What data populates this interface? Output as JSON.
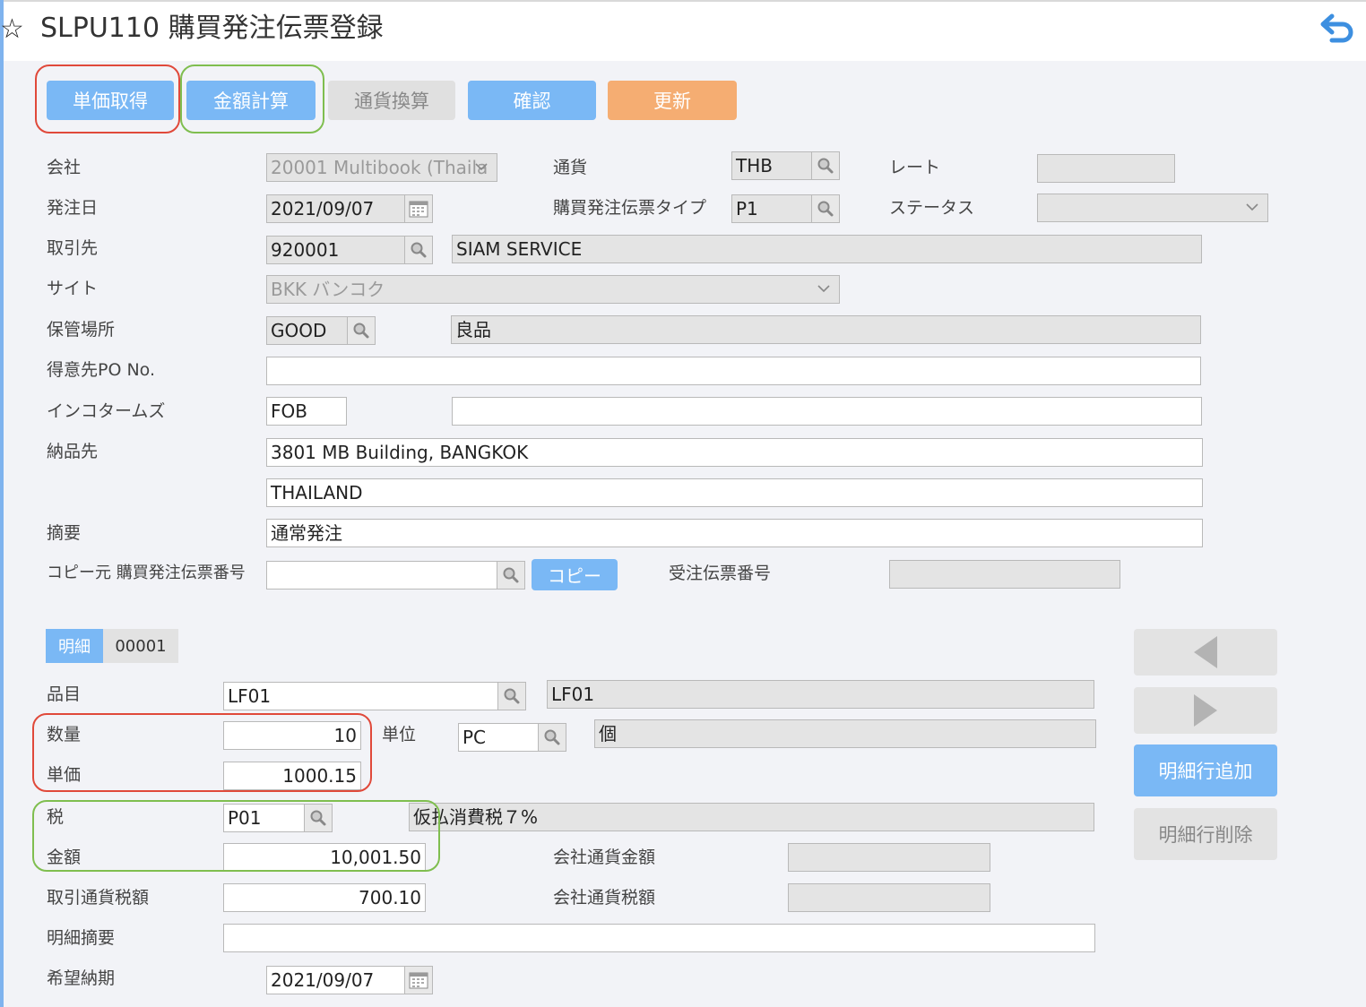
{
  "header": {
    "title": "SLPU110 購買発注伝票登録"
  },
  "toolbar": {
    "unit_price": "単価取得",
    "amount_calc": "金額計算",
    "currency_conv": "通貨換算",
    "confirm": "確認",
    "update": "更新"
  },
  "form": {
    "company": {
      "label": "会社",
      "value": "20001 Multibook (Thaila"
    },
    "currency": {
      "label": "通貨",
      "value": "THB"
    },
    "rate": {
      "label": "レート",
      "value": ""
    },
    "order_date": {
      "label": "発注日",
      "value": "2021/09/07"
    },
    "po_type": {
      "label": "購買発注伝票タイプ",
      "value": "P1"
    },
    "status": {
      "label": "ステータス",
      "value": ""
    },
    "vendor": {
      "label": "取引先",
      "code": "920001",
      "name": "SIAM SERVICE"
    },
    "site": {
      "label": "サイト",
      "value": "BKK バンコク"
    },
    "storage": {
      "label": "保管場所",
      "code": "GOOD",
      "name": "良品"
    },
    "customer_po": {
      "label": "得意先PO No.",
      "value": ""
    },
    "incoterms": {
      "label": "インコタームズ",
      "code": "FOB",
      "text": ""
    },
    "ship_to": {
      "label": "納品先",
      "line1": "3801 MB Building, BANGKOK",
      "line2": "THAILAND"
    },
    "memo": {
      "label": "摘要",
      "value": "通常発注"
    },
    "copy_source": {
      "label": "コピー元 購買発注伝票番号",
      "value": "",
      "button": "コピー"
    },
    "sales_order_no": {
      "label": "受注伝票番号",
      "value": ""
    }
  },
  "detail": {
    "tab_label": "明細",
    "line_no": "00001",
    "item": {
      "label": "品目",
      "code": "LF01",
      "name": "LF01"
    },
    "quantity": {
      "label": "数量",
      "value": "10"
    },
    "unit": {
      "label": "単位",
      "code": "PC",
      "name": "個"
    },
    "unit_price": {
      "label": "単価",
      "value": "1000.15"
    },
    "tax": {
      "label": "税",
      "code": "P01",
      "name": "仮払消費税７%"
    },
    "amount": {
      "label": "金額",
      "value": "10,001.50"
    },
    "company_amount": {
      "label": "会社通貨金額",
      "value": ""
    },
    "tax_amount": {
      "label": "取引通貨税額",
      "value": "700.10"
    },
    "company_tax": {
      "label": "会社通貨税額",
      "value": ""
    },
    "line_memo": {
      "label": "明細摘要",
      "value": ""
    },
    "delivery_date": {
      "label": "希望納期",
      "value": "2021/09/07"
    },
    "add_line": "明細行追加",
    "delete_line": "明細行削除"
  }
}
